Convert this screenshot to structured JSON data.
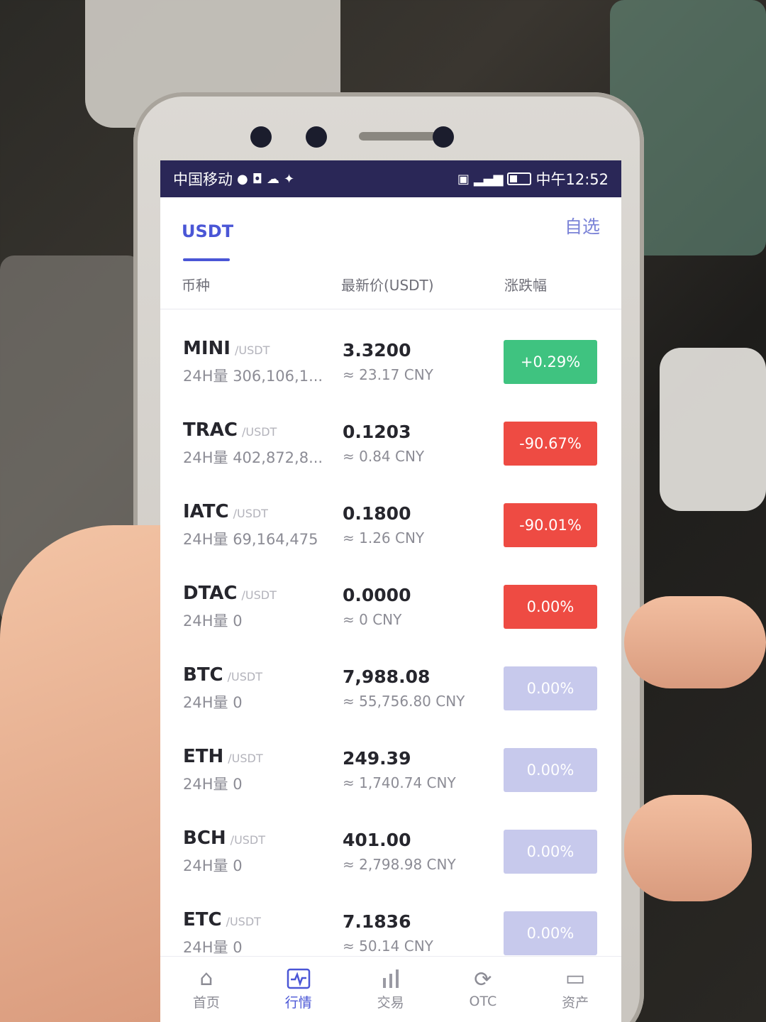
{
  "statusbar": {
    "carrier": "中国移动",
    "time": "中午12:52",
    "icons": [
      "wechat-icon",
      "app-icon",
      "cloud-icon",
      "alipay-icon",
      "hd-icon",
      "signal-icon",
      "battery-icon"
    ]
  },
  "tabs": {
    "usdt_label": "USDT",
    "favorites_label": "自选"
  },
  "columns": {
    "coin": "币种",
    "price": "最新价(USDT)",
    "change": "涨跌幅"
  },
  "rows": [
    {
      "symbol": "MINI",
      "quote": "/USDT",
      "volume": "24H量 306,106,1...",
      "price": "3.3200",
      "cny": "≈ 23.17 CNY",
      "change": "+0.29%",
      "color": "#3fc380"
    },
    {
      "symbol": "TRAC",
      "quote": "/USDT",
      "volume": "24H量 402,872,8...",
      "price": "0.1203",
      "cny": "≈ 0.84 CNY",
      "change": "-90.67%",
      "color": "#ee4b43"
    },
    {
      "symbol": "IATC",
      "quote": "/USDT",
      "volume": "24H量 69,164,475",
      "price": "0.1800",
      "cny": "≈ 1.26 CNY",
      "change": "-90.01%",
      "color": "#ee4b43"
    },
    {
      "symbol": "DTAC",
      "quote": "/USDT",
      "volume": "24H量 0",
      "price": "0.0000",
      "cny": "≈ 0 CNY",
      "change": "0.00%",
      "color": "#ee4b43"
    },
    {
      "symbol": "BTC",
      "quote": "/USDT",
      "volume": "24H量 0",
      "price": "7,988.08",
      "cny": "≈ 55,756.80 CNY",
      "change": "0.00%",
      "color": "#c7c9ec"
    },
    {
      "symbol": "ETH",
      "quote": "/USDT",
      "volume": "24H量 0",
      "price": "249.39",
      "cny": "≈ 1,740.74 CNY",
      "change": "0.00%",
      "color": "#c7c9ec"
    },
    {
      "symbol": "BCH",
      "quote": "/USDT",
      "volume": "24H量 0",
      "price": "401.00",
      "cny": "≈ 2,798.98 CNY",
      "change": "0.00%",
      "color": "#c7c9ec"
    },
    {
      "symbol": "ETC",
      "quote": "/USDT",
      "volume": "24H量 0",
      "price": "7.1836",
      "cny": "≈ 50.14 CNY",
      "change": "0.00%",
      "color": "#c7c9ec"
    }
  ],
  "nav": {
    "home": "首页",
    "market": "行情",
    "trade": "交易",
    "otc": "OTC",
    "assets": "资产"
  },
  "colors": {
    "accent": "#4a56d6",
    "up": "#3fc380",
    "down": "#ee4b43",
    "neutral": "#c7c9ec"
  }
}
